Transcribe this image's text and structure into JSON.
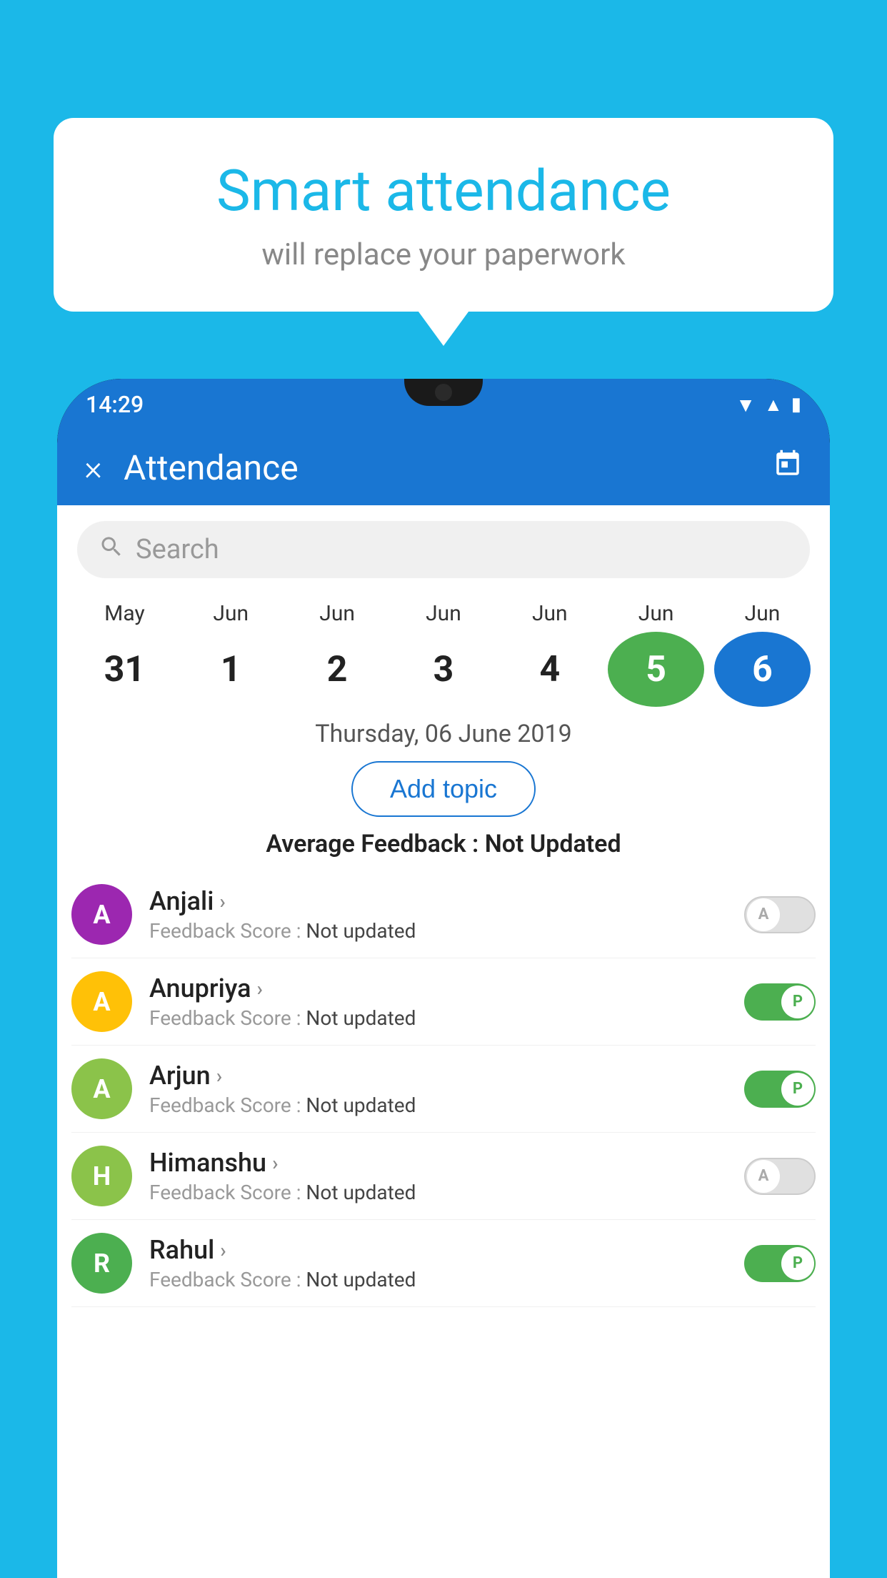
{
  "background_color": "#1BB8E8",
  "speech_bubble": {
    "title": "Smart attendance",
    "subtitle": "will replace your paperwork"
  },
  "status_bar": {
    "time": "14:29",
    "icons": [
      "wifi",
      "signal",
      "battery"
    ]
  },
  "app_bar": {
    "title": "Attendance",
    "close_label": "×",
    "calendar_icon": "📅"
  },
  "search": {
    "placeholder": "Search"
  },
  "calendar": {
    "months": [
      "May",
      "Jun",
      "Jun",
      "Jun",
      "Jun",
      "Jun",
      "Jun"
    ],
    "days": [
      "31",
      "1",
      "2",
      "3",
      "4",
      "5",
      "6"
    ],
    "today_index": 5,
    "selected_index": 6
  },
  "date_label": "Thursday, 06 June 2019",
  "add_topic_label": "Add topic",
  "avg_feedback_prefix": "Average Feedback : ",
  "avg_feedback_value": "Not Updated",
  "students": [
    {
      "name": "Anjali",
      "avatar_letter": "A",
      "avatar_color": "#9C27B0",
      "feedback_prefix": "Feedback Score : ",
      "feedback_value": "Not updated",
      "toggle_state": "off",
      "toggle_label": "A"
    },
    {
      "name": "Anupriya",
      "avatar_letter": "A",
      "avatar_color": "#FFC107",
      "feedback_prefix": "Feedback Score : ",
      "feedback_value": "Not updated",
      "toggle_state": "on",
      "toggle_label": "P"
    },
    {
      "name": "Arjun",
      "avatar_letter": "A",
      "avatar_color": "#8BC34A",
      "feedback_prefix": "Feedback Score : ",
      "feedback_value": "Not updated",
      "toggle_state": "on",
      "toggle_label": "P"
    },
    {
      "name": "Himanshu",
      "avatar_letter": "H",
      "avatar_color": "#8BC34A",
      "feedback_prefix": "Feedback Score : ",
      "feedback_value": "Not updated",
      "toggle_state": "off",
      "toggle_label": "A"
    },
    {
      "name": "Rahul",
      "avatar_letter": "R",
      "avatar_color": "#4CAF50",
      "feedback_prefix": "Feedback Score : ",
      "feedback_value": "Not updated",
      "toggle_state": "on",
      "toggle_label": "P"
    }
  ]
}
